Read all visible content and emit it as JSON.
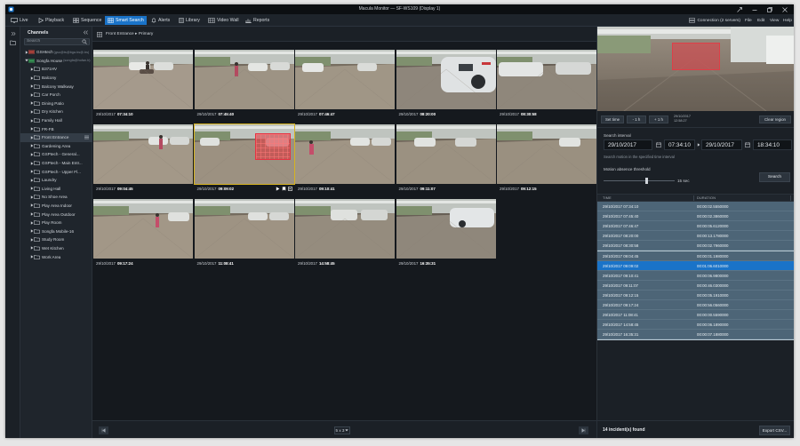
{
  "window": {
    "title": "Macula Monitor — SF-WS109 (Display 1)"
  },
  "menu": {
    "items": [
      {
        "label": "Live",
        "icon": "monitor-icon"
      },
      {
        "label": "Playback",
        "icon": "play-icon"
      },
      {
        "label": "Sequence",
        "icon": "sequence-icon"
      },
      {
        "label": "Smart Search",
        "icon": "smart-search-icon",
        "active": true
      },
      {
        "label": "Alerts",
        "icon": "bell-icon"
      },
      {
        "label": "Library",
        "icon": "library-icon"
      },
      {
        "label": "Video Wall",
        "icon": "video-wall-icon"
      },
      {
        "label": "Reports",
        "icon": "reports-icon"
      }
    ],
    "connection": "Connection (2 servers)",
    "right": [
      "File",
      "Edit",
      "View",
      "Help"
    ]
  },
  "channels": {
    "title": "Channels",
    "search_placeholder": "Search",
    "items": [
      {
        "label": "GSHtech",
        "suffix": "(gsu@ts@bga.bs@.bs)",
        "level": 0,
        "expanded": false,
        "type": "server"
      },
      {
        "label": "Songfa House",
        "suffix": "(songfa@hofan.b)",
        "level": 0,
        "expanded": true,
        "type": "server"
      },
      {
        "label": "B371HV",
        "level": 1
      },
      {
        "label": "Balcony",
        "level": 1
      },
      {
        "label": "Balcony Walkway",
        "level": 1
      },
      {
        "label": "Car Porch",
        "level": 1
      },
      {
        "label": "Dining Patio",
        "level": 1
      },
      {
        "label": "Dry Kitchen",
        "level": 1
      },
      {
        "label": "Family Hall",
        "level": 1
      },
      {
        "label": "FR-FB",
        "level": 1
      },
      {
        "label": "Front Entrance",
        "level": 1,
        "selected": true
      },
      {
        "label": "Gardening Area",
        "level": 1
      },
      {
        "label": "GSPtech - General...",
        "level": 1
      },
      {
        "label": "GSPtech - Main Entr...",
        "level": 1
      },
      {
        "label": "GSPtech - Upper Fl...",
        "level": 1
      },
      {
        "label": "Laundry",
        "level": 1
      },
      {
        "label": "Living Hall",
        "level": 1
      },
      {
        "label": "No Shoe Area",
        "level": 1
      },
      {
        "label": "Play Area Indoor",
        "level": 1
      },
      {
        "label": "Play Area Outdoor",
        "level": 1
      },
      {
        "label": "Play Room",
        "level": 1
      },
      {
        "label": "Songfa Mobile-16",
        "level": 1
      },
      {
        "label": "Study Room",
        "level": 1
      },
      {
        "label": "Wet Kitchen",
        "level": 1
      },
      {
        "label": "Work Area",
        "level": 1
      }
    ]
  },
  "breadcrumb": "Front Entrance ▸ Primary",
  "thumbnails": [
    {
      "date": "29/10/2017",
      "time": "07:34:10",
      "scene": "a"
    },
    {
      "date": "29/10/2017",
      "time": "07:45:40",
      "scene": "b"
    },
    {
      "date": "29/10/2017",
      "time": "07:46:47",
      "scene": "c"
    },
    {
      "date": "29/10/2017",
      "time": "08:20:00",
      "scene": "d"
    },
    {
      "date": "29/10/2017",
      "time": "08:30:58",
      "scene": "e"
    },
    {
      "date": "29/10/2017",
      "time": "09:04:45",
      "scene": "f"
    },
    {
      "date": "29/10/2017",
      "time": "09:09:02",
      "scene": "g",
      "selected": true
    },
    {
      "date": "29/10/2017",
      "time": "09:10:41",
      "scene": "h"
    },
    {
      "date": "29/10/2017",
      "time": "09:11:07",
      "scene": "i"
    },
    {
      "date": "29/10/2017",
      "time": "09:12:15",
      "scene": "j"
    },
    {
      "date": "29/10/2017",
      "time": "09:17:24",
      "scene": "k"
    },
    {
      "date": "29/10/2017",
      "time": "11:08:41",
      "scene": "l"
    },
    {
      "date": "29/10/2017",
      "time": "14:58:45",
      "scene": "m"
    },
    {
      "date": "29/10/2017",
      "time": "16:35:31",
      "scene": "n"
    }
  ],
  "layout_select": "5 x 3",
  "search": {
    "set_time": "Set time",
    "minus": "- 1 h",
    "plus": "+ 1 h",
    "current_date": "29/10/2017",
    "current_time": "12:58:27",
    "clear_region": "Clear region",
    "interval_label": "Search interval",
    "start_date": "29/10/2017",
    "start_time": "07:34:10",
    "end_date": "29/10/2017",
    "end_time": "18:34:10",
    "hint": "Search motion in the specified time interval",
    "threshold_label": "Motion absence threshold",
    "threshold_value": "15 sec",
    "threshold_level": 0.6,
    "search_button": "Search"
  },
  "results": {
    "columns": [
      "TIME",
      "DURATION"
    ],
    "rows": [
      {
        "time": "29/10/2017 07:34:10",
        "duration": "00:00:02.5550000"
      },
      {
        "time": "29/10/2017 07:45:40",
        "duration": "00:00:02.3860000"
      },
      {
        "time": "29/10/2017 07:46:47",
        "duration": "00:00:05.6120000"
      },
      {
        "time": "29/10/2017 08:20:00",
        "duration": "00:00:13.1780000"
      },
      {
        "time": "29/10/2017 08:30:58",
        "duration": "00:00:02.7960000"
      },
      {
        "time": "29/10/2017 09:04:45",
        "duration": "00:00:01.1980000"
      },
      {
        "time": "29/10/2017 09:09:02",
        "duration": "00:01:06.6010000",
        "selected": true
      },
      {
        "time": "29/10/2017 09:10:41",
        "duration": "00:00:06.9800000"
      },
      {
        "time": "29/10/2017 09:11:07",
        "duration": "00:00:46.0300000"
      },
      {
        "time": "29/10/2017 09:12:15",
        "duration": "00:00:05.1910000"
      },
      {
        "time": "29/10/2017 09:17:24",
        "duration": "00:00:56.0560000"
      },
      {
        "time": "29/10/2017 11:08:41",
        "duration": "00:00:00.5590000"
      },
      {
        "time": "29/10/2017 14:58:45",
        "duration": "00:00:06.1890000"
      },
      {
        "time": "29/10/2017 16:35:31",
        "duration": "00:00:07.1880000"
      }
    ],
    "count_text": "14 incident(s) found",
    "export_button": "Export CSV..."
  },
  "colors": {
    "accent": "#1a73c8",
    "selection_outline": "#d6b321",
    "motion_region": "#e63241"
  }
}
